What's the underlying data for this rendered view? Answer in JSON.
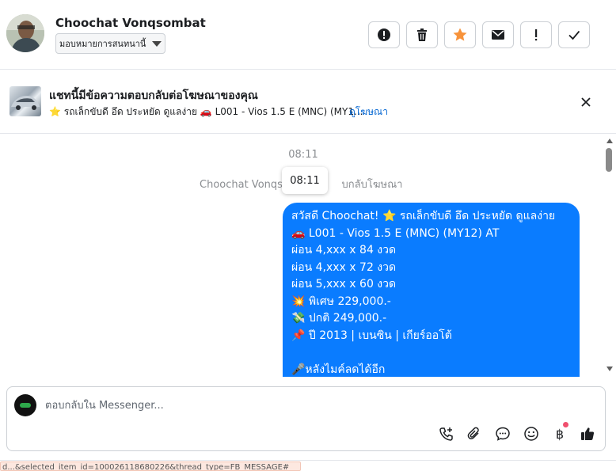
{
  "header": {
    "contact_name": "Choochat Vonqsombat",
    "assign_label": "มอบหมายการสนทนานี้"
  },
  "actions": [
    {
      "name": "alert-icon"
    },
    {
      "name": "trash-icon"
    },
    {
      "name": "star-icon"
    },
    {
      "name": "mail-icon"
    },
    {
      "name": "exclamation-icon"
    },
    {
      "name": "check-icon"
    }
  ],
  "ad_banner": {
    "title": "แชทนี้มีข้อความตอบกลับต่อโฆษณาของคุณ",
    "subtitle": "⭐ รถเล็กขับดี อึด ประหยัด ดูแลง่าย 🚗 L001 - Vios 1.5 E (MNC) (MY1...",
    "link": "ดูโฆษณา"
  },
  "conversation": {
    "timestamp": "08:11",
    "tooltip": "08:11",
    "system_text": "Choochat Vonqsom",
    "system_text_tail": "บกลับโฆษณา",
    "message_lines": [
      "สวัสดี Choochat! ⭐ รถเล็กขับดี อึด ประหยัด ดูแลง่าย",
      "🚗 L001 - Vios 1.5 E (MNC) (MY12) AT",
      "ผ่อน 4,xxx x 84 งวด",
      "ผ่อน 4,xxx x 72 งวด",
      "ผ่อน 5,xxx x 60 งวด",
      "💥 พิเศษ 229,000.-",
      "💸 ปกติ 249,000.-",
      "📌 ปี 2013 | เบนซิน | เกียร์ออโต้",
      "",
      "🎤หลังไมค์ลดได้อีก"
    ]
  },
  "composer": {
    "placeholder": "ตอบกลับใน Messenger...",
    "baht_symbol": "฿"
  },
  "status_url": "d...&selected_item_id=100026118680226&thread_type=FB_MESSAGE#",
  "colors": {
    "accent_blue": "#0a7cff",
    "star_orange": "#f7923a",
    "link_blue": "#0064d1",
    "notif_dot": "#f0506e"
  }
}
